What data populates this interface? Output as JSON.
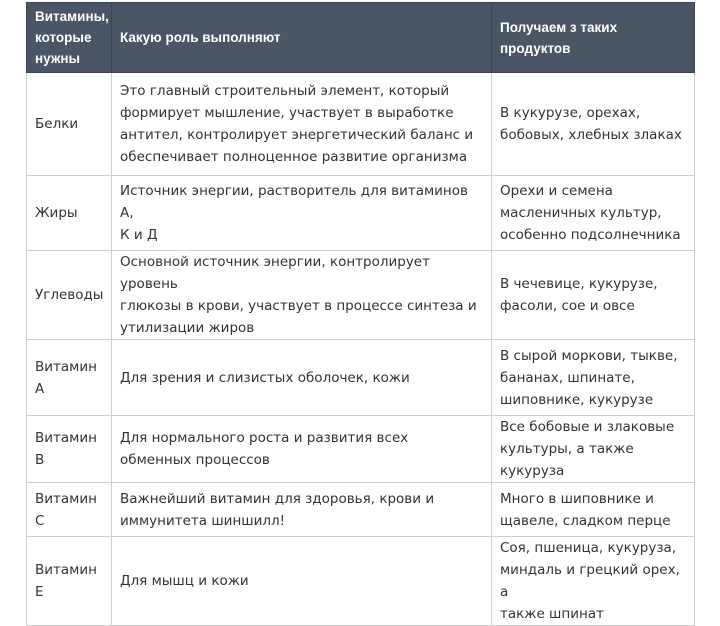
{
  "table": {
    "headers": [
      "Витамины,\nкоторые\nнужны",
      "Какую роль выполняют",
      "Получаем з таких продуктов"
    ],
    "rows": [
      {
        "name": "Белки",
        "role": "Это главный строительный элемент, который\nформирует мышление, участвует в выработке\nантител, контролирует энергетический баланс и\nобеспечивает полноценное развитие организма",
        "products": "В кукурузе, орехах,\nбобовых, хлебных злаках"
      },
      {
        "name": "Жиры",
        "role": "Источник энергии, растворитель для витаминов А,\nК и Д",
        "products": "Орехи и семена\nмасленичных культур,\nособенно подсолнечника"
      },
      {
        "name": "Углеводы",
        "role": "Основной источник энергии, контролирует уровень\nглюкозы в крови, участвует в процессе синтеза и\nутилизации жиров",
        "products": "В чечевице, кукурузе,\nфасоли, сое и овсе"
      },
      {
        "name": "Витамин\nА",
        "role": "Для зрения и слизистых оболочек, кожи",
        "products": "В сырой моркови, тыкве,\nбананах, шпинате,\nшиповнике, кукурузе"
      },
      {
        "name": "Витамин\nВ",
        "role": "Для нормального роста и развития всех\nобменных процессов",
        "products": "Все бобовые и злаковые\nкультуры, а также кукуруза"
      },
      {
        "name": "Витамин\nС",
        "role": "Важнейший витамин для здоровья, крови и\nиммунитета шиншилл!",
        "products": "Много в шиповнике и\nщавеле, сладком перце"
      },
      {
        "name": "Витамин\nЕ",
        "role": "Для мышц и кожи",
        "products": "Соя, пшеница,  кукуруза,\nминдаль и грецкий орех, а\nтакже  шпинат"
      }
    ]
  },
  "colors": {
    "header_bg": "#4a5566",
    "header_text": "#ffffff",
    "cell_text": "#333333",
    "border": "#cfcfcf"
  }
}
